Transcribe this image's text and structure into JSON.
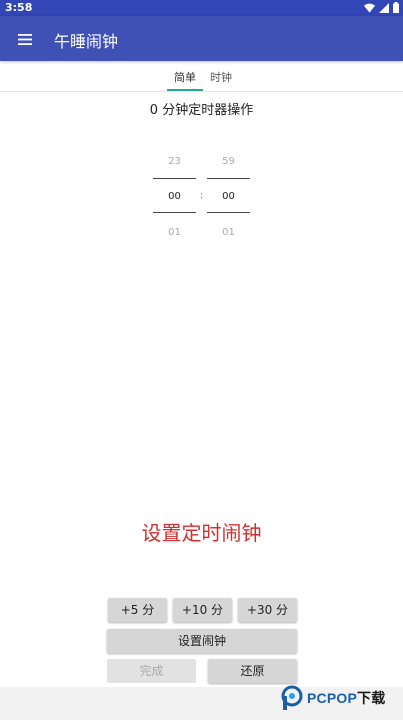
{
  "status": {
    "time": "3:58"
  },
  "app": {
    "title": "午睡闹钟",
    "menu_icon": "hamburger-menu-icon",
    "accent": "#3f51b5",
    "tab_indicator_color": "#26a69a"
  },
  "tabs": [
    {
      "label": "简单",
      "selected": true
    },
    {
      "label": "时钟",
      "selected": false
    }
  ],
  "timer_text": "0 分钟定时器操作",
  "picker": {
    "hours": {
      "prev": "23",
      "current": "00",
      "next": "01"
    },
    "minutes": {
      "prev": "59",
      "current": "00",
      "next": "01"
    },
    "separator": ":"
  },
  "big_label": {
    "text": "设置定时闹钟",
    "color": "#d32f2f"
  },
  "buttons": {
    "plus5": "+5 分",
    "plus10": "+10 分",
    "plus30": "+30 分",
    "set_alarm": "设置闹钟",
    "done": "完成",
    "restore": "还原"
  },
  "watermark": {
    "brand": "PCPOP",
    "suffix": "下载"
  }
}
